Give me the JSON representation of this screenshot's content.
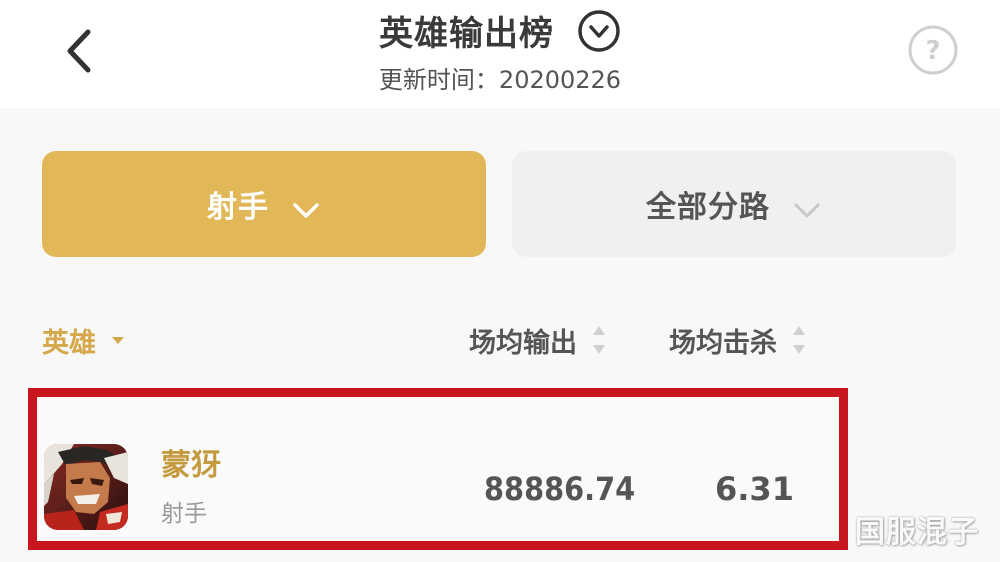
{
  "header": {
    "back_icon": "chevron-left-icon",
    "title": "英雄输出榜",
    "toggle_icon": "circle-chevron-down-icon",
    "subtitle": "更新时间：20200226",
    "help_icon": "question-circle-icon"
  },
  "filters": {
    "role": {
      "label": "射手",
      "icon": "chevron-down-icon",
      "active": true
    },
    "lane": {
      "label": "全部分路",
      "icon": "chevron-down-icon",
      "active": false
    }
  },
  "columns": {
    "hero": {
      "label": "英雄",
      "icon": "caret-down-icon"
    },
    "avg_damage": {
      "label": "场均输出",
      "icon": "sort-icon"
    },
    "avg_kills": {
      "label": "场均击杀",
      "icon": "sort-icon"
    }
  },
  "rows": [
    {
      "name": "蒙犽",
      "role": "射手",
      "avg_damage": "88886.74",
      "avg_kills": "6.31",
      "avatar_icon": "hero-portrait"
    }
  ],
  "watermark": "国服混子",
  "colors": {
    "accent_gold": "#e2b757",
    "gold_text": "#d4a84b",
    "highlight_red": "#c7161d",
    "background": "#f8f8f8"
  }
}
